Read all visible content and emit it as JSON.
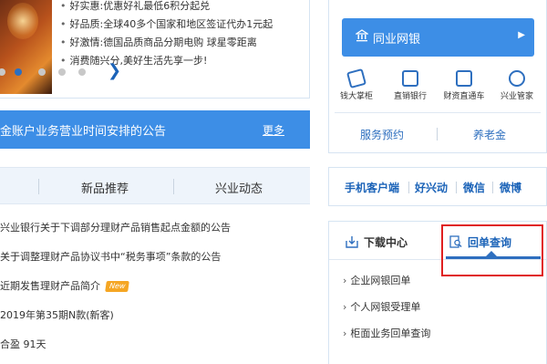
{
  "promo": {
    "items": [
      "好实惠:优惠好礼最低6积分起兑",
      "好品质:全球40多个国家和地区签证代办1元起",
      "好激情:德国品质商品分期电购 球星零距离",
      "消费随兴分,美好生活先享一步!"
    ],
    "next_arrow": "❯"
  },
  "notice": {
    "title": "金账户业务营业时间安排的公告",
    "more": "更多"
  },
  "news_tabs": [
    "新品推荐",
    "兴业动态"
  ],
  "news": [
    "兴业银行关于下调部分理财产品销售起点金额的公告",
    "关于调整理财产品协议书中“税务事项”条款的公告",
    "近期发售理财产品简介",
    "2019年第35期N款(新客)",
    "合盈 91天"
  ],
  "new_badge": "New",
  "corporate_banking": {
    "label": "同业网银",
    "arrow": "▶"
  },
  "services": [
    {
      "label": "钱大掌柜",
      "icon": "wallet-icon"
    },
    {
      "label": "直销银行",
      "icon": "card-icon"
    },
    {
      "label": "财资直通车",
      "icon": "car-icon"
    },
    {
      "label": "兴业管家",
      "icon": "butler-icon"
    }
  ],
  "sublinks": [
    "服务预约",
    "养老金"
  ],
  "social": [
    "手机客户端",
    "好兴动",
    "微信",
    "微博"
  ],
  "query_tabs": {
    "download": "下载中心",
    "receipt": "回单查询"
  },
  "receipt_links": [
    "企业网银回单",
    "个人网银受理单",
    "柜面业务回单查询"
  ],
  "colors": {
    "brand_blue": "#3d8ee6",
    "link_blue": "#1b63b8",
    "highlight_red": "#e02020",
    "badge_orange": "#f5a623"
  }
}
